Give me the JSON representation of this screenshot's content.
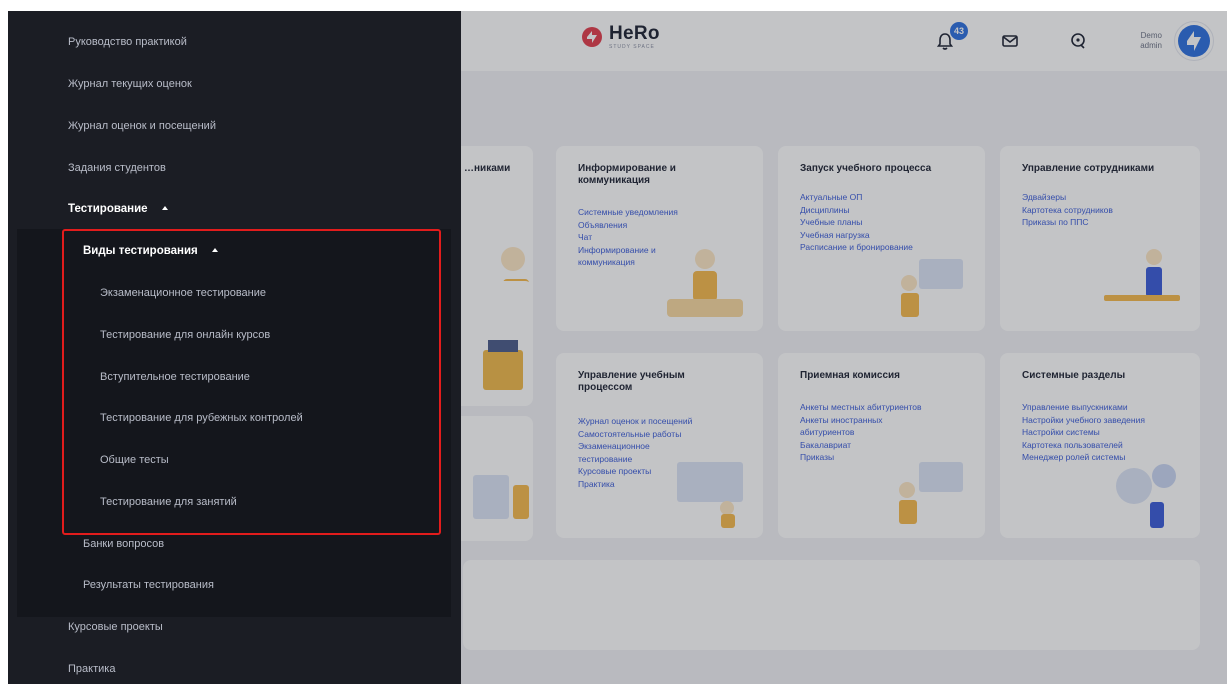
{
  "header": {
    "logo_title": "HeRo",
    "logo_subtitle": "STUDY SPACE",
    "notifications_count": "43",
    "user_role": "Demo",
    "user_name": "admin"
  },
  "cards": [
    {
      "title": "…никами",
      "links": []
    },
    {
      "title": "Информирование и коммуникация",
      "links": [
        "Системные уведомления",
        "Объявления",
        "Чат",
        "Информирование и коммуникация"
      ]
    },
    {
      "title": "Запуск учебного процесса",
      "links": [
        "Актуальные ОП",
        "Дисциплины",
        "Учебные планы",
        "Учебная нагрузка",
        "Расписание и бронирование"
      ]
    },
    {
      "title": "Управление сотрудниками",
      "links": [
        "Эдвайзеры",
        "Картотека сотрудников",
        "Приказы по ППС"
      ]
    },
    {
      "title": "Управление учебным процессом",
      "links": [
        "Журнал оценок и посещений",
        "Самостоятельные работы",
        "Экзаменационное тестирование",
        "Курсовые проекты",
        "Практика"
      ]
    },
    {
      "title": "Приемная комиссия",
      "links": [
        "Анкеты местных абитуриентов",
        "Анкеты иностранных абитуриентов",
        "Бакалавриат",
        "Приказы"
      ]
    },
    {
      "title": "Системные разделы",
      "links": [
        "Управление выпускниками",
        "Настройки учебного заведения",
        "Настройки системы",
        "Картотека пользователей",
        "Менеджер ролей системы"
      ]
    }
  ],
  "menu": {
    "items_top": [
      "Руководство практикой",
      "Журнал текущих оценок",
      "Журнал оценок и посещений",
      "Задания студентов"
    ],
    "testing": "Тестирование",
    "test_types": "Виды тестирования",
    "test_type_items": [
      "Экзаменационное тестирование",
      "Тестирование для онлайн курсов",
      "Вступительное тестирование",
      "Тестирование для рубежных контролей",
      "Общие тесты",
      "Тестирование для занятий"
    ],
    "question_banks": "Банки вопросов",
    "test_results": "Результаты тестирования",
    "course_projects": "Курсовые проекты",
    "practice": "Практика"
  },
  "colors": {
    "accent": "#2b6fe0",
    "highlight": "#e21c1c",
    "menu_bg": "#1b1d24"
  }
}
